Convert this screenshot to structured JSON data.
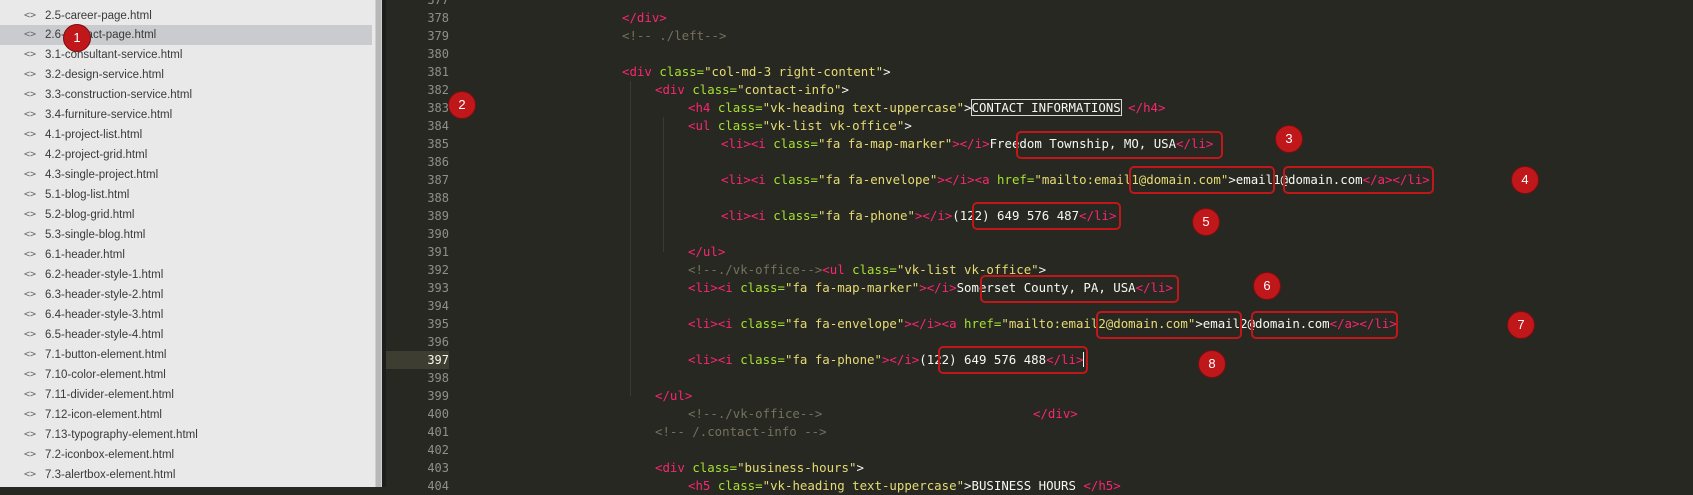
{
  "sidebar": {
    "items": [
      {
        "label": "2.5-career-page.html"
      },
      {
        "label": "2.6-contact-page.html",
        "active": true
      },
      {
        "label": "3.1-consultant-service.html"
      },
      {
        "label": "3.2-design-service.html"
      },
      {
        "label": "3.3-construction-service.html"
      },
      {
        "label": "3.4-furniture-service.html"
      },
      {
        "label": "4.1-project-list.html"
      },
      {
        "label": "4.2-project-grid.html"
      },
      {
        "label": "4.3-single-project.html"
      },
      {
        "label": "5.1-blog-list.html"
      },
      {
        "label": "5.2-blog-grid.html"
      },
      {
        "label": "5.3-single-blog.html"
      },
      {
        "label": "6.1-header.html"
      },
      {
        "label": "6.2-header-style-1.html"
      },
      {
        "label": "6.3-header-style-2.html"
      },
      {
        "label": "6.4-header-style-3.html"
      },
      {
        "label": "6.5-header-style-4.html"
      },
      {
        "label": "7.1-button-element.html"
      },
      {
        "label": "7.10-color-element.html"
      },
      {
        "label": "7.11-divider-element.html"
      },
      {
        "label": "7.12-icon-element.html"
      },
      {
        "label": "7.13-typography-element.html"
      },
      {
        "label": "7.2-iconbox-element.html"
      },
      {
        "label": "7.3-alertbox-element.html"
      }
    ],
    "file_icon": "<>"
  },
  "editor": {
    "line_numbers": [
      "377",
      "378",
      "379",
      "380",
      "381",
      "382",
      "383",
      "384",
      "385",
      "386",
      "387",
      "388",
      "389",
      "390",
      "391",
      "392",
      "393",
      "394",
      "395",
      "396",
      "397",
      "398",
      "399",
      "400",
      "401",
      "402",
      "403",
      "404"
    ],
    "current_line": "397",
    "code": {
      "l378_tag": "</div>",
      "l379_cmt": "<!-- ./left-->",
      "l381_open": "<div ",
      "l381_attr": "class=",
      "l381_val": "\"col-md-3 right-content\"",
      "l381_close": ">",
      "l382_open": "<div ",
      "l382_attr": "class=",
      "l382_val": "\"contact-info\"",
      "l382_close": ">",
      "l383_open": "<h4 ",
      "l383_attr": "class=",
      "l383_val": "\"vk-heading text-uppercase\"",
      "l383_close": ">",
      "l383_text": "CONTACT INFORMATIONS",
      "l383_end": " </h4>",
      "l384_open": "<ul ",
      "l384_attr": "class=",
      "l384_val": "\"vk-list vk-office\"",
      "l384_close": ">",
      "li_open": "<li><i ",
      "attr_class": "class=",
      "val_marker": "\"fa fa-map-marker\"",
      "val_envelope": "\"fa fa-envelope\"",
      "val_phone": "\"fa fa-phone\"",
      "i_close": "></i>",
      "i_close_a": "></i><a ",
      "attr_href": "href=",
      "li_end": "</li>",
      "a_li_end": "</a></li>",
      "quote": "\"",
      "gt": ">",
      "mailto": "mailto:",
      "address1": "Freedom Township, MO, USA",
      "email1": "email1@domain.com",
      "phone1": "(122) 649 576 487",
      "ul_end": "</ul>",
      "l392_cmt": "<!--./vk-office-->",
      "l392_open": "<ul ",
      "address2": "Somerset County, PA, USA",
      "email2": "email2@domain.com",
      "phone2": "(122) 649 576 488",
      "l399_tag": "</ul>",
      "l400_cmt": "<!--./vk-office-->",
      "l400_tag": "</div>",
      "l401_cmt": "<!-- /.contact-info -->",
      "l403_open": "<div ",
      "l403_val": "\"business-hours\"",
      "l404_open": "<h5 ",
      "l404_val": "\"vk-heading text-uppercase\"",
      "l404_text": "BUSINESS HOURS ",
      "l404_end": "</h5>"
    }
  },
  "annotations": [
    "1",
    "2",
    "3",
    "4",
    "5",
    "6",
    "7",
    "8"
  ],
  "colors": {
    "sidebar_bg": "#e9e9e9",
    "sidebar_active": "#c9cbcf",
    "editor_bg": "#272822",
    "tag": "#f92672",
    "attribute": "#a6e22e",
    "string": "#e6db74",
    "comment": "#75715e",
    "annotation": "#c0171b"
  }
}
